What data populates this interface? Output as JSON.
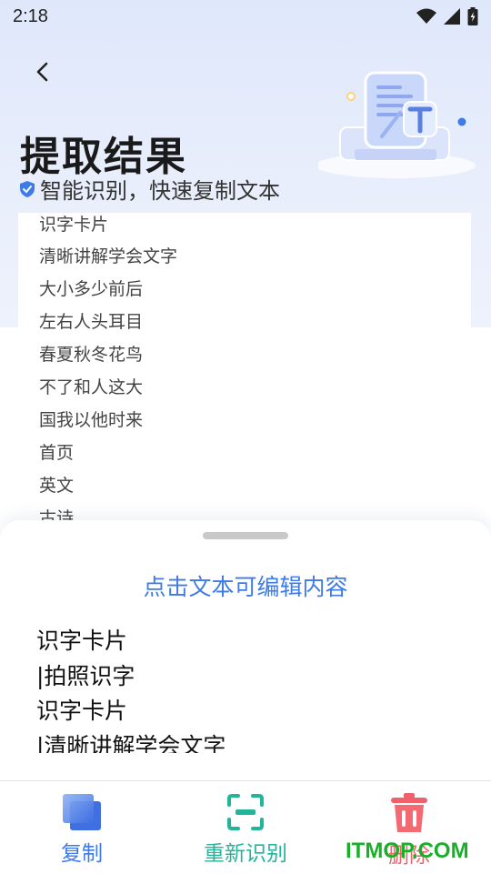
{
  "status_bar": {
    "time": "2:18"
  },
  "header": {
    "title": "提取结果",
    "subtitle": "智能识别，快速复制文本"
  },
  "text_list": [
    "识字卡片",
    "清晰讲解学会文字",
    "大小多少前后",
    "左右人头耳目",
    "春夏秋冬花鸟",
    "不了和人这大",
    "国我以他时来",
    "首页",
    "英文",
    "古诗"
  ],
  "sheet": {
    "hint": "点击文本可编辑内容",
    "lines": [
      "识字卡片",
      "|拍照识字",
      "识字卡片",
      "|清晰讲解学会文字"
    ]
  },
  "actions": {
    "copy": {
      "label": "复制",
      "color": "#3e7be6"
    },
    "rerecognize": {
      "label": "重新识别",
      "color": "#23b59a"
    },
    "delete": {
      "label": "删除",
      "color": "#f0616b"
    }
  },
  "watermark": "ITMOP.COM"
}
